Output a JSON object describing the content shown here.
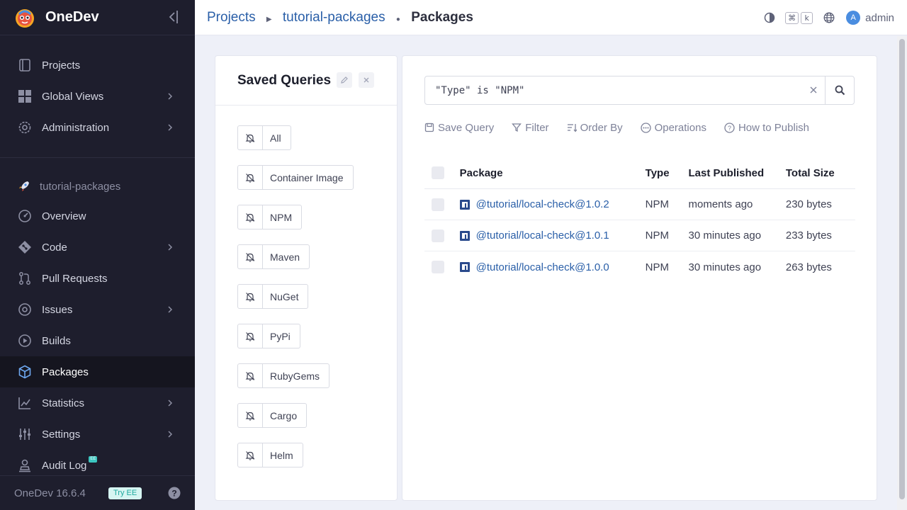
{
  "brand": {
    "name": "OneDev"
  },
  "sidebar": {
    "global_items": [
      {
        "label": "Projects",
        "icon": "projects-icon"
      },
      {
        "label": "Global Views",
        "icon": "global-views-icon"
      },
      {
        "label": "Administration",
        "icon": "administration-icon"
      }
    ],
    "project_name": "tutorial-packages",
    "project_items": [
      {
        "label": "Overview",
        "icon": "overview-icon"
      },
      {
        "label": "Code",
        "icon": "code-icon"
      },
      {
        "label": "Pull Requests",
        "icon": "pull-requests-icon"
      },
      {
        "label": "Issues",
        "icon": "issues-icon"
      },
      {
        "label": "Builds",
        "icon": "builds-icon"
      },
      {
        "label": "Packages",
        "icon": "packages-icon",
        "active": true
      },
      {
        "label": "Statistics",
        "icon": "statistics-icon"
      },
      {
        "label": "Settings",
        "icon": "settings-icon"
      },
      {
        "label": "Audit Log",
        "icon": "audit-log-icon",
        "badge": "EE"
      }
    ],
    "version": "OneDev 16.6.4",
    "try_ee": "Try EE"
  },
  "breadcrumb": {
    "projects": "Projects",
    "project": "tutorial-packages",
    "current": "Packages"
  },
  "topbar": {
    "shortcut_keys": [
      "⌘",
      "k"
    ],
    "user_initial": "A",
    "username": "admin"
  },
  "saved_queries": {
    "title": "Saved Queries",
    "items": [
      "All",
      "Container Image",
      "NPM",
      "Maven",
      "NuGet",
      "PyPi",
      "RubyGems",
      "Cargo",
      "Helm"
    ]
  },
  "search": {
    "value": "\"Type\" is \"NPM\""
  },
  "toolbar": {
    "save_query": "Save Query",
    "filter": "Filter",
    "order_by": "Order By",
    "operations": "Operations",
    "how_to_publish": "How to Publish"
  },
  "table": {
    "columns": [
      "Package",
      "Type",
      "Last Published",
      "Total Size"
    ],
    "rows": [
      {
        "package": "@tutorial/local-check@1.0.2",
        "type": "NPM",
        "last_published": "moments ago",
        "total_size": "230 bytes"
      },
      {
        "package": "@tutorial/local-check@1.0.1",
        "type": "NPM",
        "last_published": "30 minutes ago",
        "total_size": "233 bytes"
      },
      {
        "package": "@tutorial/local-check@1.0.0",
        "type": "NPM",
        "last_published": "30 minutes ago",
        "total_size": "263 bytes"
      }
    ]
  },
  "colors": {
    "sidebar_bg": "#1e1e2d",
    "link": "#2a5fa8",
    "accent": "#4a8de0"
  }
}
